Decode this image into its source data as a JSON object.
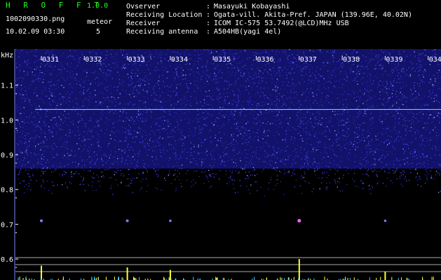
{
  "app": {
    "title": "H R O F F T",
    "version": "1.0.0",
    "filename": "1002090330.png",
    "datetime": "10.02.09 03:30",
    "meteor_label": "meteor",
    "meteor_count": "5"
  },
  "info": [
    {
      "label": "Ovserver",
      "value": "Masayuki Kobayashi"
    },
    {
      "label": "Receiving Location",
      "value": "Ogata-vill. Akita-Pref. JAPAN (139.96E, 40.02N)"
    },
    {
      "label": "Receiver",
      "value": "ICOM IC-575 53.7492(@LCD)MHz USB"
    },
    {
      "label": "Receiving antenna",
      "value": "A504HB(yagi 4el)"
    }
  ],
  "colon": ":",
  "chart_data": {
    "type": "heatmap",
    "ylabel": "kHz",
    "x_ticks": [
      "0331",
      "0332",
      "0333",
      "0334",
      "0335",
      "0336",
      "0337",
      "0338",
      "0339",
      "0340"
    ],
    "y_ticks": [
      "1.1",
      "1.0",
      "0.9",
      "0.8",
      "0.7",
      "0.6"
    ],
    "ylim": [
      0.58,
      1.2
    ],
    "carrier_khz": 1.03,
    "noise_top_khz": 1.2,
    "noise_bottom_khz": 0.86,
    "meteor_events": [
      {
        "time": "03:31",
        "freq_khz": 0.71,
        "strength": 0.6
      },
      {
        "time": "03:33",
        "freq_khz": 0.71,
        "strength": 0.5
      },
      {
        "time": "03:34",
        "freq_khz": 0.71,
        "strength": 0.35
      },
      {
        "time": "03:37",
        "freq_khz": 0.71,
        "strength": 1.0
      },
      {
        "time": "03:39",
        "freq_khz": 0.71,
        "strength": 0.25
      }
    ],
    "colors": {
      "noise": "#3a3adc",
      "carrier": "#4fd0ff",
      "grid": "#ffffff",
      "meter": "#ffff30"
    }
  }
}
